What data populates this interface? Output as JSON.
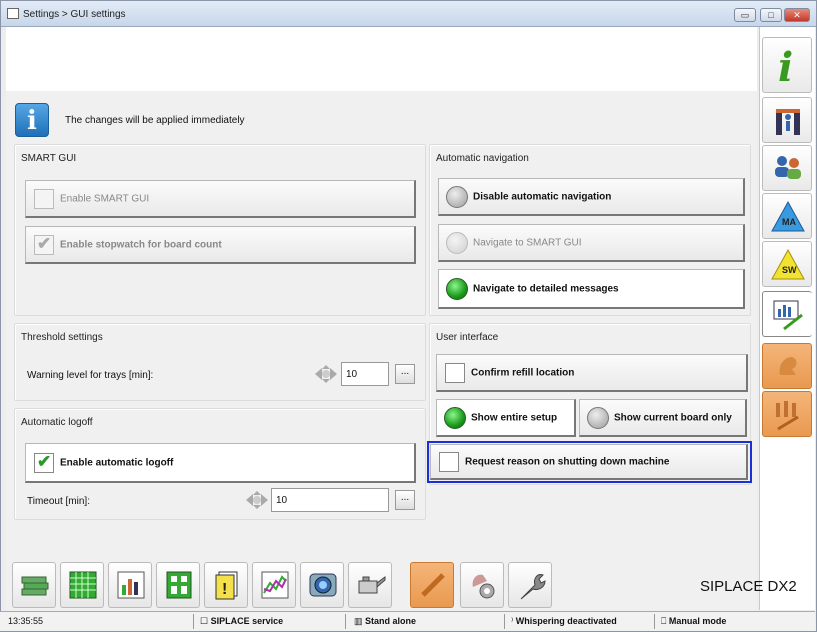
{
  "window": {
    "title": "Settings > GUI settings",
    "minimize": "▭",
    "maximize": "□",
    "close": "✕"
  },
  "info": {
    "icon_char": "i",
    "message": "The changes will be applied immediately"
  },
  "smart_gui": {
    "title": "SMART GUI",
    "enable_smart_gui": {
      "label": "Enable SMART GUI",
      "checked": false,
      "enabled": false
    },
    "enable_stopwatch": {
      "label": "Enable stopwatch for board count",
      "checked": true,
      "enabled": false
    }
  },
  "automatic_navigation": {
    "title": "Automatic navigation",
    "options": [
      {
        "label": "Disable automatic navigation",
        "selected": false,
        "enabled": true
      },
      {
        "label": "Navigate to SMART GUI",
        "selected": false,
        "enabled": false
      },
      {
        "label": "Navigate to detailed messages",
        "selected": true,
        "enabled": true
      }
    ]
  },
  "threshold_settings": {
    "title": "Threshold settings",
    "warning_level_label": "Warning level for trays [min]:",
    "warning_level_value": "10",
    "browse": "..."
  },
  "user_interface": {
    "title": "User interface",
    "confirm_refill": {
      "label": "Confirm refill location",
      "checked": false
    },
    "show_entire_setup": {
      "label": "Show entire setup",
      "selected": true
    },
    "show_current_board": {
      "label": "Show current board only",
      "selected": false
    },
    "request_reason": {
      "label": "Request reason on shutting down machine",
      "checked": false
    }
  },
  "automatic_logoff": {
    "title": "Automatic logoff",
    "enable": {
      "label": "Enable automatic logoff",
      "checked": true
    },
    "timeout_label": "Timeout [min]:",
    "timeout_value": "10",
    "browse": "..."
  },
  "sidebar": {
    "items": [
      {
        "name": "info",
        "icon": "info-icon"
      },
      {
        "name": "station",
        "icon": "station-icon"
      },
      {
        "name": "users",
        "icon": "users-icon"
      },
      {
        "name": "ma",
        "icon": "ma-triangle-icon",
        "text": "MA"
      },
      {
        "name": "sw",
        "icon": "sw-triangle-icon",
        "text": "SW"
      },
      {
        "name": "gui-settings",
        "icon": "chart-settings-icon",
        "active": true
      },
      {
        "name": "hand",
        "icon": "hand-icon",
        "highlighted": true
      },
      {
        "name": "tools",
        "icon": "tools-icon",
        "highlighted": true
      }
    ]
  },
  "toolbar": {
    "items": [
      "money-stack-icon",
      "grid-icon",
      "bar-chart-icon",
      "board-layout-icon",
      "cards-warning-icon",
      "line-chart-icon",
      "camera-lens-icon",
      "oil-can-icon",
      "pen-icon",
      "hand-gear-icon",
      "wrench-icon"
    ],
    "brand": "SIPLACE DX2"
  },
  "status": {
    "time": "13:35:55",
    "service": "SIPLACE service",
    "mode1": "Stand alone",
    "whisper": "Whispering deactivated",
    "mode2": "Manual mode"
  },
  "colors": {
    "accent_blue": "#1a2fd6",
    "active_green": "#1a9a1a",
    "orange": "#e99950"
  }
}
